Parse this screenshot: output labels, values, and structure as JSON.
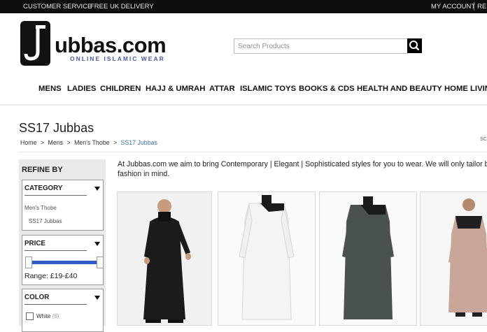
{
  "topbar": {
    "customer_service": "CUSTOMER SERVICE",
    "delivery": "FREE UK DELIVERY",
    "account": "MY ACCOUNT",
    "register": "RE"
  },
  "brand": {
    "name": "Jubbas.com",
    "logo_text": "ubbas.com",
    "tagline": "ONLINE ISLAMIC WEAR"
  },
  "search": {
    "placeholder": "Search Products",
    "value": ""
  },
  "nav": [
    "MENS",
    "LADIES",
    "CHILDREN",
    "HAJJ & UMRAH",
    "ATTAR",
    "ISLAMIC TOYS",
    "BOOKS & CDS",
    "HEALTH AND BEAUTY",
    "HOME LIVIN"
  ],
  "page": {
    "title": "SS17 Jubbas",
    "breadcrumb": [
      "Home",
      ">",
      "Mens",
      ">",
      "Men's Thobe",
      ">",
      "SS17 Jubbas"
    ],
    "sort_label": "SC",
    "intro": "At Jubbas.com we aim to bring Contemporary | Elegant | Sophisticated styles for you to wear. We will only tailor best",
    "intro_line2": "fashion in mind."
  },
  "sidebar": {
    "refine_title": "REFINE BY",
    "category": {
      "label": "CATEGORY",
      "options": [
        "Men's Thobe",
        "SS17 Jubbas"
      ]
    },
    "price": {
      "label": "PRICE",
      "range": "Range: £19-£40",
      "min": 19,
      "max": 40,
      "selected_fraction": 1.0
    },
    "color": {
      "label": "COLOR",
      "options": [
        {
          "name": "White",
          "count": "(6)",
          "checked": false
        }
      ]
    }
  },
  "products": [
    {
      "alt": "black jubba"
    },
    {
      "alt": "white jubba"
    },
    {
      "alt": "grey jubba"
    },
    {
      "alt": "beige jubba"
    }
  ],
  "colors": {
    "topbar": "#0d0d0d",
    "accent_blue": "#2f5fc6",
    "sidebar_bg": "#e9e9e9",
    "link": "#3a6ea5"
  }
}
